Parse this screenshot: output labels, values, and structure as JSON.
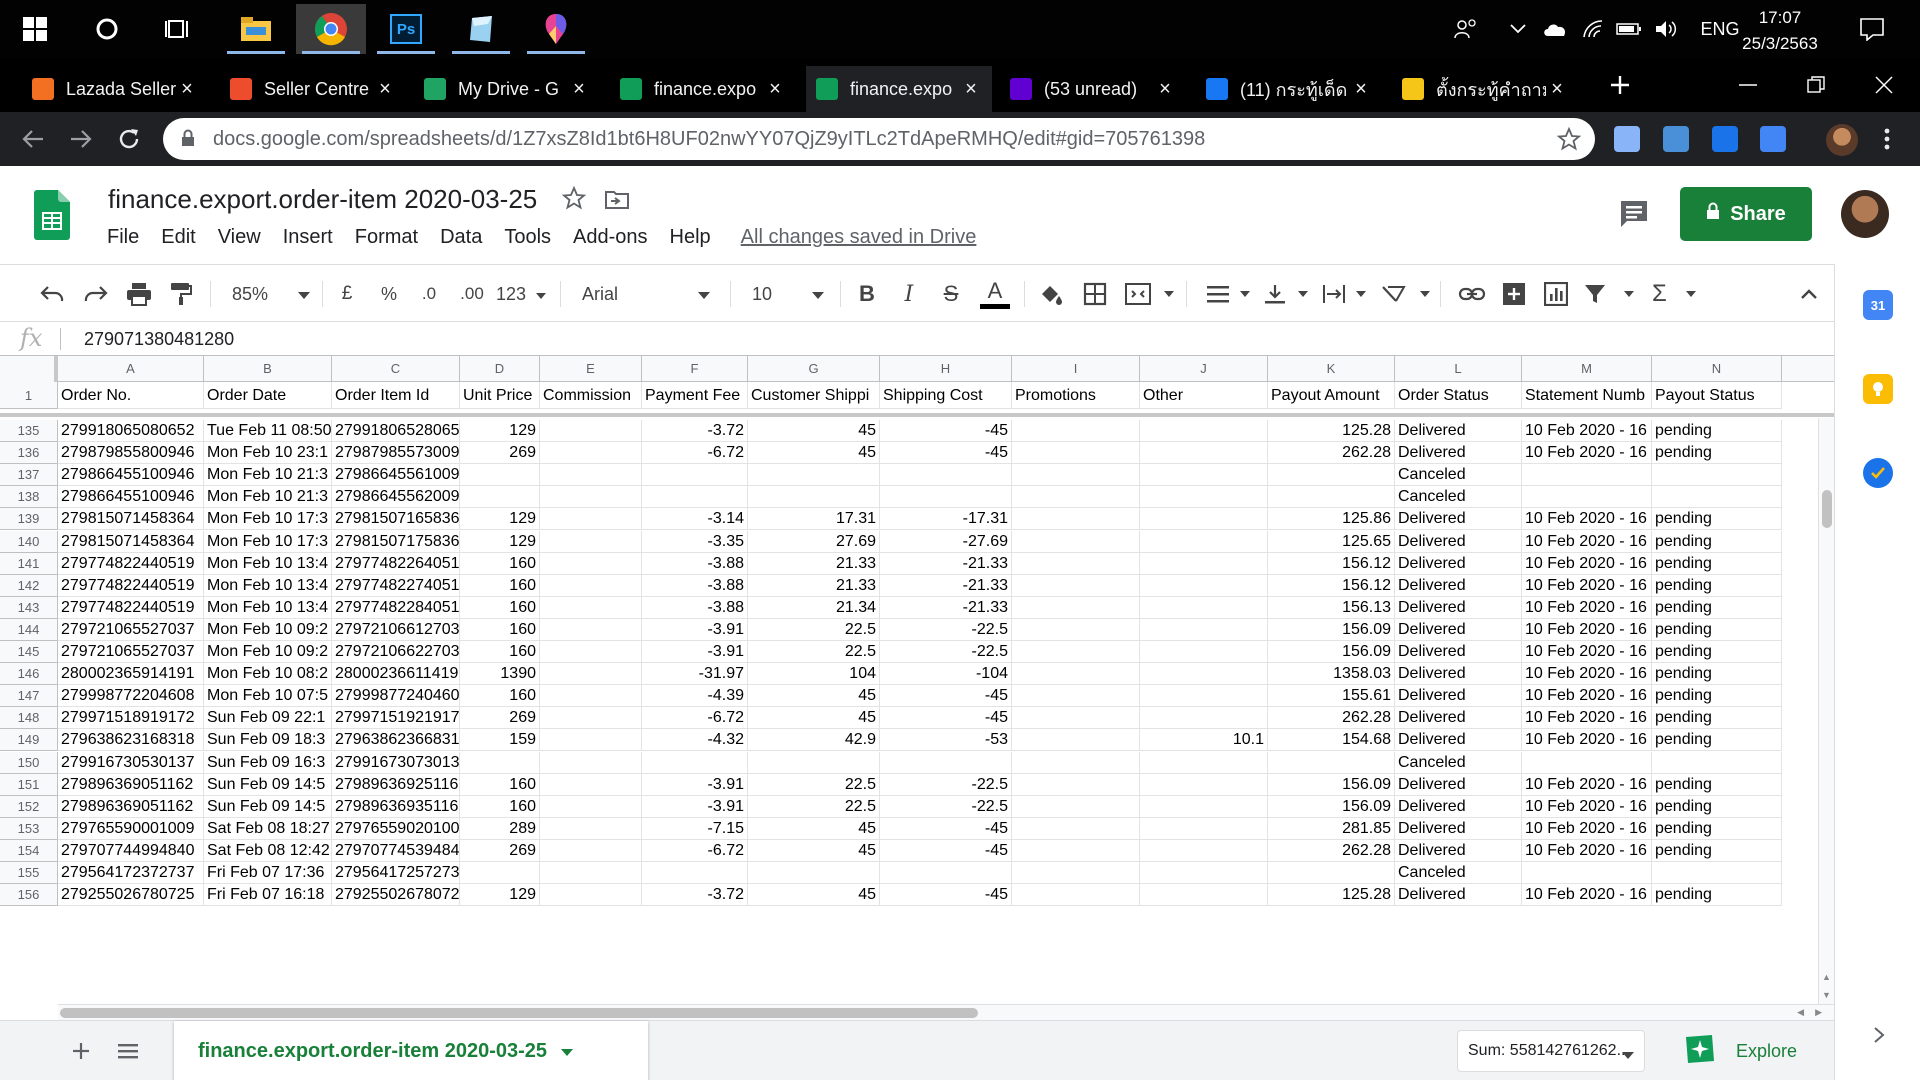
{
  "taskbar": {
    "time": "17:07",
    "date": "25/3/2563",
    "language": "ENG",
    "apps": [
      "windows-start",
      "cortana",
      "task-view",
      "file-explorer",
      "chrome",
      "photoshop",
      "app-notepad",
      "app-paint"
    ]
  },
  "browser": {
    "tabs": [
      {
        "label": "Lazada Seller",
        "favicon": "lazada",
        "color": "#f36f21"
      },
      {
        "label": "Seller Centre",
        "favicon": "shopee",
        "color": "#ee4d2d"
      },
      {
        "label": "My Drive - G",
        "favicon": "google-drive",
        "color": "#1fa463"
      },
      {
        "label": "finance.expo",
        "favicon": "google-sheets",
        "color": "#0f9d58"
      },
      {
        "label": "finance.expo",
        "favicon": "google-sheets",
        "color": "#0f9d58",
        "active": true
      },
      {
        "label": "(53 unread)",
        "favicon": "yahoo-mail",
        "color": "#6001d2"
      },
      {
        "label": "(11) กระทู้เด็ด",
        "favicon": "facebook",
        "color": "#1877f2"
      },
      {
        "label": "ตั้งกระทู้คำถาม",
        "favicon": "pantip",
        "color": "#f5c518"
      }
    ],
    "url": "docs.google.com/spreadsheets/d/1Z7xsZ8Id1bt6H8UF02nwYY07QjZ9yITLc2TdApeRMHQ/edit#gid=705761398"
  },
  "doc": {
    "title": "finance.export.order-item 2020-03-25",
    "menu": [
      "File",
      "Edit",
      "View",
      "Insert",
      "Format",
      "Data",
      "Tools",
      "Add-ons",
      "Help"
    ],
    "saved_status": "All changes saved in Drive",
    "share_label": "Share"
  },
  "toolbar": {
    "zoom": "85%",
    "currency": "£",
    "percent": "%",
    "dec_less": ".0",
    "dec_more": ".00",
    "more_formats": "123",
    "font": "Arial",
    "font_size": "10"
  },
  "formula": {
    "value": "279071380481280"
  },
  "sheet": {
    "columns": [
      "A",
      "B",
      "C",
      "D",
      "E",
      "F",
      "G",
      "H",
      "I",
      "J",
      "K",
      "L",
      "M",
      "N"
    ],
    "header_row_num": "1",
    "headers": [
      "Order No.",
      "Order Date",
      "Order Item Id",
      "Unit Price",
      "Commission",
      "Payment Fee",
      "Customer Shippi",
      "Shipping Cost",
      "Promotions",
      "Other",
      "Payout Amount",
      "Order Status",
      "Statement Numb",
      "Payout Status"
    ],
    "rows": [
      {
        "n": "135",
        "c": [
          "279918065080652",
          "Tue Feb 11 08:50",
          "27991806528065",
          "129",
          "",
          "-3.72",
          "45",
          "-45",
          "",
          "",
          "125.28",
          "Delivered",
          "10 Feb 2020 - 16",
          "pending"
        ]
      },
      {
        "n": "136",
        "c": [
          "279879855800946",
          "Mon Feb 10 23:1",
          "27987985573009",
          "269",
          "",
          "-6.72",
          "45",
          "-45",
          "",
          "",
          "262.28",
          "Delivered",
          "10 Feb 2020 - 16",
          "pending"
        ]
      },
      {
        "n": "137",
        "c": [
          "279866455100946",
          "Mon Feb 10 21:3",
          "27986645561009",
          "",
          "",
          "",
          "",
          "",
          "",
          "",
          "",
          "Canceled",
          "",
          ""
        ]
      },
      {
        "n": "138",
        "c": [
          "279866455100946",
          "Mon Feb 10 21:3",
          "27986645562009",
          "",
          "",
          "",
          "",
          "",
          "",
          "",
          "",
          "Canceled",
          "",
          ""
        ]
      },
      {
        "n": "139",
        "c": [
          "279815071458364",
          "Mon Feb 10 17:3",
          "27981507165836",
          "129",
          "",
          "-3.14",
          "17.31",
          "-17.31",
          "",
          "",
          "125.86",
          "Delivered",
          "10 Feb 2020 - 16",
          "pending"
        ]
      },
      {
        "n": "140",
        "c": [
          "279815071458364",
          "Mon Feb 10 17:3",
          "27981507175836",
          "129",
          "",
          "-3.35",
          "27.69",
          "-27.69",
          "",
          "",
          "125.65",
          "Delivered",
          "10 Feb 2020 - 16",
          "pending"
        ]
      },
      {
        "n": "141",
        "c": [
          "279774822440519",
          "Mon Feb 10 13:4",
          "27977482264051",
          "160",
          "",
          "-3.88",
          "21.33",
          "-21.33",
          "",
          "",
          "156.12",
          "Delivered",
          "10 Feb 2020 - 16",
          "pending"
        ]
      },
      {
        "n": "142",
        "c": [
          "279774822440519",
          "Mon Feb 10 13:4",
          "27977482274051",
          "160",
          "",
          "-3.88",
          "21.33",
          "-21.33",
          "",
          "",
          "156.12",
          "Delivered",
          "10 Feb 2020 - 16",
          "pending"
        ]
      },
      {
        "n": "143",
        "c": [
          "279774822440519",
          "Mon Feb 10 13:4",
          "27977482284051",
          "160",
          "",
          "-3.88",
          "21.34",
          "-21.33",
          "",
          "",
          "156.13",
          "Delivered",
          "10 Feb 2020 - 16",
          "pending"
        ]
      },
      {
        "n": "144",
        "c": [
          "279721065527037",
          "Mon Feb 10 09:2",
          "27972106612703",
          "160",
          "",
          "-3.91",
          "22.5",
          "-22.5",
          "",
          "",
          "156.09",
          "Delivered",
          "10 Feb 2020 - 16",
          "pending"
        ]
      },
      {
        "n": "145",
        "c": [
          "279721065527037",
          "Mon Feb 10 09:2",
          "27972106622703",
          "160",
          "",
          "-3.91",
          "22.5",
          "-22.5",
          "",
          "",
          "156.09",
          "Delivered",
          "10 Feb 2020 - 16",
          "pending"
        ]
      },
      {
        "n": "146",
        "c": [
          "280002365914191",
          "Mon Feb 10 08:2",
          "28000236611419",
          "1390",
          "",
          "-31.97",
          "104",
          "-104",
          "",
          "",
          "1358.03",
          "Delivered",
          "10 Feb 2020 - 16",
          "pending"
        ]
      },
      {
        "n": "147",
        "c": [
          "279998772204608",
          "Mon Feb 10 07:5",
          "27999877240460",
          "160",
          "",
          "-4.39",
          "45",
          "-45",
          "",
          "",
          "155.61",
          "Delivered",
          "10 Feb 2020 - 16",
          "pending"
        ]
      },
      {
        "n": "148",
        "c": [
          "279971518919172",
          "Sun Feb 09 22:1",
          "27997151921917",
          "269",
          "",
          "-6.72",
          "45",
          "-45",
          "",
          "",
          "262.28",
          "Delivered",
          "10 Feb 2020 - 16",
          "pending"
        ]
      },
      {
        "n": "149",
        "c": [
          "279638623168318",
          "Sun Feb 09 18:3",
          "27963862366831",
          "159",
          "",
          "-4.32",
          "42.9",
          "-53",
          "",
          "10.1",
          "154.68",
          "Delivered",
          "10 Feb 2020 - 16",
          "pending"
        ]
      },
      {
        "n": "150",
        "c": [
          "279916730530137",
          "Sun Feb 09 16:3",
          "27991673073013",
          "",
          "",
          "",
          "",
          "",
          "",
          "",
          "",
          "Canceled",
          "",
          ""
        ]
      },
      {
        "n": "151",
        "c": [
          "279896369051162",
          "Sun Feb 09 14:5",
          "27989636925116",
          "160",
          "",
          "-3.91",
          "22.5",
          "-22.5",
          "",
          "",
          "156.09",
          "Delivered",
          "10 Feb 2020 - 16",
          "pending"
        ]
      },
      {
        "n": "152",
        "c": [
          "279896369051162",
          "Sun Feb 09 14:5",
          "27989636935116",
          "160",
          "",
          "-3.91",
          "22.5",
          "-22.5",
          "",
          "",
          "156.09",
          "Delivered",
          "10 Feb 2020 - 16",
          "pending"
        ]
      },
      {
        "n": "153",
        "c": [
          "279765590001009",
          "Sat Feb 08 18:27",
          "27976559020100",
          "289",
          "",
          "-7.15",
          "45",
          "-45",
          "",
          "",
          "281.85",
          "Delivered",
          "10 Feb 2020 - 16",
          "pending"
        ]
      },
      {
        "n": "154",
        "c": [
          "279707744994840",
          "Sat Feb 08 12:42",
          "27970774539484",
          "269",
          "",
          "-6.72",
          "45",
          "-45",
          "",
          "",
          "262.28",
          "Delivered",
          "10 Feb 2020 - 16",
          "pending"
        ]
      },
      {
        "n": "155",
        "c": [
          "279564172372737",
          "Fri Feb 07 17:36",
          "27956417257273",
          "",
          "",
          "",
          "",
          "",
          "",
          "",
          "",
          "Canceled",
          "",
          ""
        ]
      },
      {
        "n": "156",
        "c": [
          "279255026780725",
          "Fri Feb 07 16:18",
          "27925502678072",
          "129",
          "",
          "-3.72",
          "45",
          "-45",
          "",
          "",
          "125.28",
          "Delivered",
          "10 Feb 2020 - 16",
          "pending"
        ]
      }
    ]
  },
  "bottom": {
    "sheet_tab": "finance.export.order-item 2020-03-25",
    "sum": "Sum: 558142761262...",
    "explore_label": "Explore"
  },
  "side_panel": {
    "calendar_label": "31"
  },
  "colors": {
    "sheets_green": "#188038",
    "chrome_dark": "#202124",
    "grid_line": "#e2e3e3"
  }
}
